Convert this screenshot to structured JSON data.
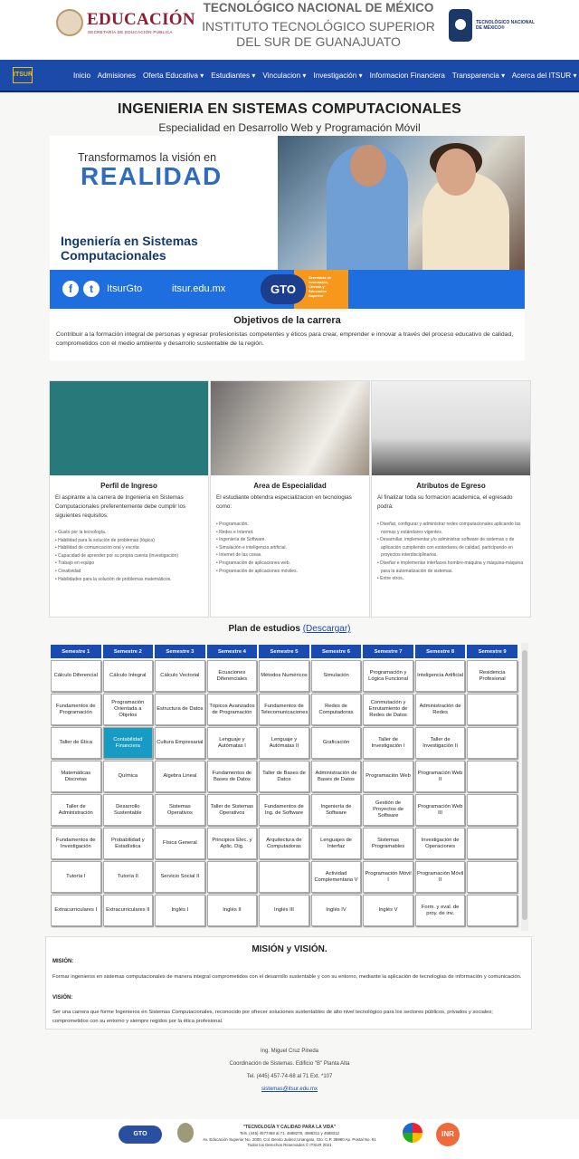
{
  "header": {
    "educacion": "EDUCACIÓN",
    "educacion_sub": "SECRETARÍA DE EDUCACIÓN PÚBLICA",
    "line1": "TECNOLÓGICO NACIONAL DE MÉXICO",
    "line2": "INSTITUTO TECNOLÓGICO SUPERIOR",
    "line3": "DEL SUR DE GUANAJUATO",
    "tecnm_logo_text": "TECNOLÓGICO NACIONAL DE MÉXICO®"
  },
  "nav": {
    "logo": "ITSUR",
    "items": [
      "Inicio",
      "Admisiones",
      "Oferta Educativa ▾",
      "Estudiantes ▾",
      "Vinculacion ▾",
      "Investigación ▾",
      "Informacion Financiera",
      "Transparencia ▾",
      "Acerca del ITSUR ▾"
    ]
  },
  "page": {
    "title": "INGENIERIA EN SISTEMAS COMPUTACIONALES",
    "subtitle": "Especialidad en Desarrollo Web y Programación Móvil"
  },
  "banner": {
    "line1": "Transformamos la visión en",
    "line2": "REALIDAD",
    "line3": "Ingeniería en Sistemas Computacionales",
    "handle": "ItsurGto",
    "site": "itsur.edu.mx",
    "gto": "GTO",
    "gto_sub": "Secretaría de Innovación, Ciencia y Educación Superior"
  },
  "objetivos": {
    "heading": "Objetivos de la carrera",
    "text": "Contribuir a la formación integral de personas y egresar profesionistas competentes y éticos para crear, emprender e innovar a través del proceso educativo de calidad, comprometidos con el medio ambiente y desarrollo sustentable de la región."
  },
  "cards": [
    {
      "heading": "Perfil de Ingreso",
      "text": "El aspirante a la carrera de Ingeniería en Sistemas Computacionales preferentemente debe cumplir los siguientes requisitos:",
      "items": [
        "Gusto por la tecnología.",
        "Habilidad para la solución de problemas (lógica)",
        "Habilidad de comunicación oral y escrita",
        "Capacidad de aprender por su propia cuenta (investigación)",
        "Trabajo en equipo",
        "Creatividad",
        "Habilidades para la solución de problemas matemáticos."
      ]
    },
    {
      "heading": "Area de Especialidad",
      "text": "El estudiante obtendra especializacion en tecnologias como:",
      "items": [
        "Programación.",
        "Redes e Internet.",
        "Ingeniería de Software.",
        "Simulación e inteligencia artificial.",
        "Internet de las cosas.",
        "Programación de aplicaciones web.",
        "Programación de aplicaciones móviles."
      ]
    },
    {
      "heading": "Atributos de Egreso",
      "text": "Al finalizar toda su formacion academica, el egresado podrá:",
      "items": [
        "Diseñar, configurar y administrar redes computacionales aplicando las normas y estándares vigentes.",
        "Desarrollar, implementar y/o administrar software de sistemas o de aplicación cumpliendo con estándares de calidad, participando en proyectos interdisciplinarios.",
        "Diseñar e implementar interfaces hombre-máquina y máquina-máquina para la automatización de sistemas.",
        "Entre otros.."
      ]
    }
  ],
  "plan": {
    "heading": "Plan de estudios",
    "link": "(Descargar)",
    "semesters": [
      "Semestre 1",
      "Semestre 2",
      "Semestre 3",
      "Semestre 4",
      "Semestre 5",
      "Semestre 6",
      "Semestre 7",
      "Semestre 8",
      "Semestre 9"
    ],
    "rows": [
      [
        "Cálculo Diferencial",
        "Cálculo Integral",
        "Cálculo Vectorial",
        "Ecuaciones Diferenciales",
        "Métodos Numéricos",
        "Simulación",
        "Programación y Lógica Funcional",
        "Inteligencia Artificial",
        "Residencia Profesional"
      ],
      [
        "Fundamentos de Programación",
        "Programación Orientada a Objetos",
        "Estructura de Datos",
        "Tópicos Avanzados de Programación",
        "Fundamentos de Telecomunicaciones",
        "Redes de Computadoras",
        "Conmutación y Enrutamiento de Redes de Datos",
        "Administración de Redes",
        ""
      ],
      [
        "Taller de Ética",
        "Contabilidad Financiera",
        "Cultura Empresarial",
        "Lenguaje y Autómatas I",
        "Lenguaje y Autómatas II",
        "Graficación",
        "Taller de Investigación I",
        "Taller de Investigación II",
        ""
      ],
      [
        "Matemáticas Discretas",
        "Química",
        "Algebra Lineal",
        "Fundamentos de Bases de Datos",
        "Taller de Bases de Datos",
        "Administración de Bases de Datos",
        "Programación Web",
        "Programación Web II",
        ""
      ],
      [
        "Taller de Administración",
        "Desarrollo Sustentable",
        "Sistemas Operativos",
        "Taller de Sistemas Operativos",
        "Fundamentos de Ing. de Software",
        "Ingeniería de Software",
        "Gestión de Proyectos de Software",
        "Programación Web III",
        ""
      ],
      [
        "Fundamentos de Investigación",
        "Probabilidad y Estadística",
        "Física General",
        "Principios Elec. y Aplic. Dig.",
        "Arquitectura de Computadoras",
        "Lenguajes de Interfaz",
        "Sistemas Programables",
        "Investigación de Operaciones",
        ""
      ],
      [
        "Tutoría I",
        "Tutoría II",
        "Servicio Social II",
        "",
        "",
        "Actividad Complementaria V",
        "Programación Móvil I",
        "Programación Móvil II",
        ""
      ],
      [
        "Extracurriculares I",
        "Extracurriculares II",
        "Inglés I",
        "Inglés II",
        "Inglés III",
        "Inglés IV",
        "Inglés V",
        "Form. y eval. de proy. de inv.",
        ""
      ]
    ]
  },
  "mision_vision": {
    "heading": "MISIÓN y VISIÓN.",
    "mision_label": "MISIÓN:",
    "mision": "Formar ingenieros en sistemas computacionales de manera integral comprometidos con el desarrollo sustentable y con su entorno, mediante la aplicación de tecnologías de información y comunicación.",
    "vision_label": "VISIÓN:",
    "vision": "Ser una carrera que forme Ingenieros en Sistemas Computacionales, reconocido por ofrecer soluciones sustentables de alto nivel tecnológico para los sectores públicos, privados y sociales; comprometidos con su entorno y siempre regidos por la ética profesional."
  },
  "contact": {
    "name": "Ing. Miguel Cruz Pineda",
    "role": "Coordinación de Sistemas. Edificio \"B\" Planta Alta",
    "phone": "Tel. (445) 457-74-68 al 71 Ext. *107",
    "email": "sistemas@itsur.edu.mx"
  },
  "footer": {
    "gto": "GTO",
    "inr": "INR",
    "slogan": "\"TECNOLOGÍA Y CALIDAD PARA LA VIDA\"",
    "tel": "Tels. (445) 4577468 al 71, 4588278, 4588311 y 4588312",
    "address": "Av. Educación Superior No. 2000, Col. Benito Juárez,Uriangato, Gto. C.P. 38980 Ap. Postal No. 61",
    "rights": "Todos los Derechos Reservados © ITSUR 2021"
  }
}
